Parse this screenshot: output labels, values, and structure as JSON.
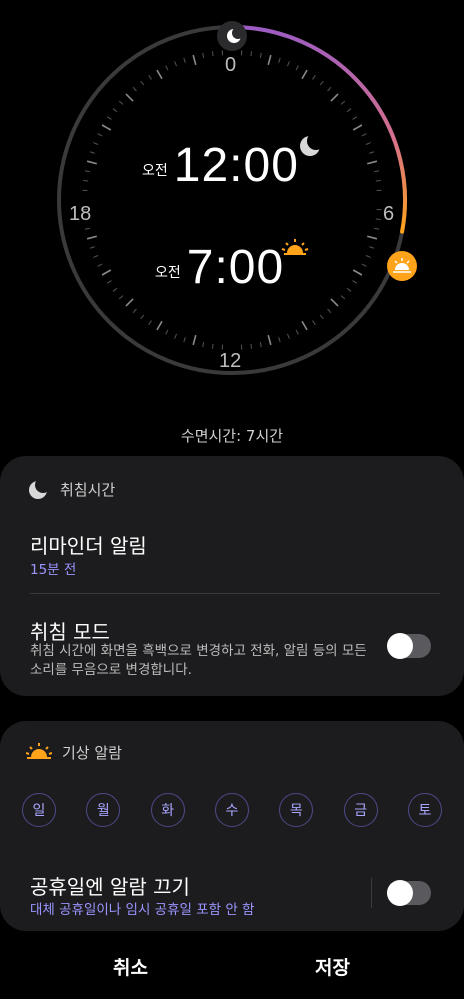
{
  "clock": {
    "dial_numbers": {
      "top": "0",
      "right": "6",
      "bottom": "12",
      "left": "18"
    },
    "bedtime": {
      "ampm": "오전",
      "time": "12:00"
    },
    "wake": {
      "ampm": "오전",
      "time": "7:00"
    },
    "arc_color_start": "#9c5cc4",
    "arc_color_end": "#ffa31a"
  },
  "sleep_duration": "수면시간: 7시간",
  "bedtime_section": {
    "header": "취침시간",
    "reminder": {
      "title": "리마인더 알림",
      "value": "15분 전"
    },
    "sleep_mode": {
      "title": "취침 모드",
      "description": "취침 시간에 화면을 흑백으로 변경하고 전화, 알림 등의 모든 소리를 무음으로 변경합니다.",
      "enabled": false
    }
  },
  "wake_section": {
    "header": "기상 알람",
    "days": [
      "일",
      "월",
      "화",
      "수",
      "목",
      "금",
      "토"
    ],
    "holiday_off": {
      "title": "공휴일엔 알람 끄기",
      "subtitle": "대체 공휴일이나 임시 공휴일 포함 안 함",
      "enabled": false
    }
  },
  "actions": {
    "cancel": "취소",
    "save": "저장"
  },
  "colors": {
    "accent_purple": "#9a95ff",
    "sun_orange": "#ffa31a",
    "card_bg": "#1c1c1e"
  }
}
